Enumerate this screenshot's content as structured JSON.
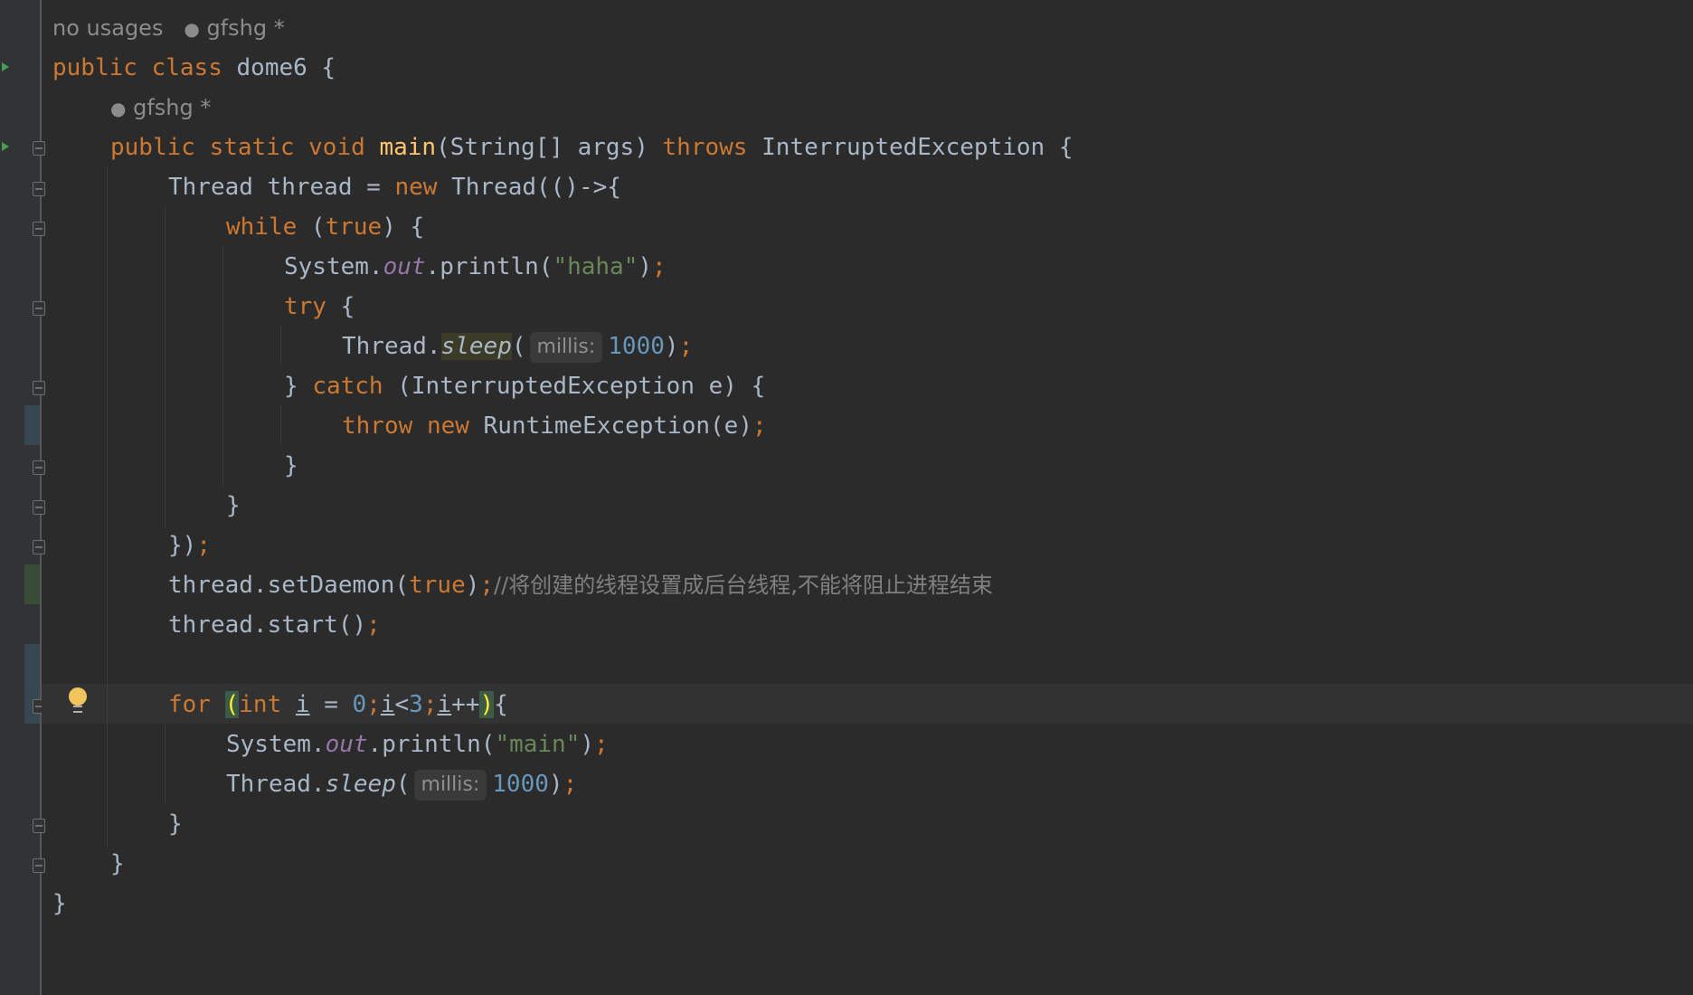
{
  "inlay": {
    "usages": "no usages",
    "author1": "gfshg *",
    "author2": "gfshg *"
  },
  "code": {
    "l1_public": "public",
    "l1_class": "class",
    "l1_name": "dome6 {",
    "l3_public": "public",
    "l3_static": "static",
    "l3_void": "void",
    "l3_main": "main",
    "l3_params": "(String[] args)",
    "l3_throws": "throws",
    "l3_exc": "InterruptedException {",
    "l4_a": "Thread thread = ",
    "l4_new": "new",
    "l4_b": " Thread(()->{",
    "l5_while": "while",
    "l5_open": " (",
    "l5_true": "true",
    "l5_close": ") {",
    "l6_sys": "System.",
    "l6_out": "out",
    "l6_println": ".println(",
    "l6_str": "\"haha\"",
    "l6_close": ")",
    "semi": ";",
    "l7_try": "try",
    "l7_brace": " {",
    "l8_thread": "Thread.",
    "l8_sleep": "sleep",
    "l8_open": "(",
    "param_hint": "millis:",
    "num_1000": "1000",
    "close_paren": ")",
    "l9_brace": "} ",
    "l9_catch": "catch",
    "l9_rest": " (InterruptedException e) {",
    "l10_throw": "throw",
    "l10_new": "new",
    "l10_rest": " RuntimeException(e)",
    "close_brace": "}",
    "l13_close": "})",
    "l14_a": "thread.setDaemon(",
    "l14_true": "true",
    "l14_b": ")",
    "l14_comment": "//将创建的线程设置成后台线程,不能将阻止进程结束",
    "l15_start": "thread.start()",
    "l17_for": "for",
    "l17_paren_open": "(",
    "l17_int": "int",
    "l17_i": "i",
    "l17_eq": " = ",
    "l17_zero": "0",
    "l17_i2": "i",
    "l17_lt": "<",
    "l17_three": "3",
    "l17_i3": "i",
    "l17_inc": "++",
    "l17_paren_close": ")",
    "l17_brace": "{",
    "l18_str": "\"main\""
  }
}
